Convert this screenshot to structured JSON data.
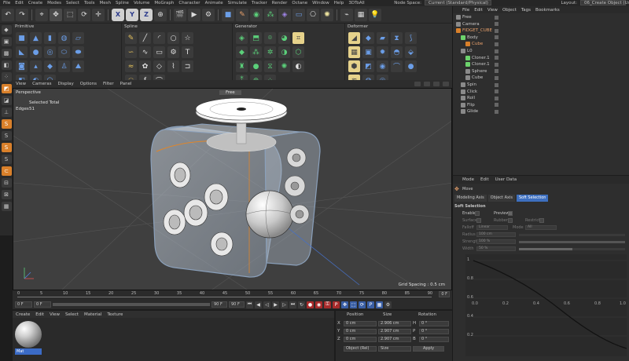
{
  "menubar": {
    "items": [
      "File",
      "Edit",
      "Create",
      "Modes",
      "Select",
      "Tools",
      "Mesh",
      "Spline",
      "Volume",
      "MoGraph",
      "Character",
      "Animate",
      "Simulate",
      "Tracker",
      "Render",
      "Octane",
      "Window",
      "Help",
      "3DToAll"
    ],
    "node_space_label": "Node Space:",
    "node_space_value": "Current (Standard/Physical)",
    "layout_label": "Layout:",
    "layout_value": "06_Create Object (User)"
  },
  "palette": {
    "primitive_title": "Primitive",
    "spline_title": "Spline",
    "generator_title": "Generator",
    "deformer_title": "Deformer"
  },
  "viewport": {
    "menu": [
      "View",
      "Cameras",
      "Display",
      "Options",
      "Filter",
      "Panel"
    ],
    "perspective": "Perspective",
    "selected_total": "Selected Total",
    "edges_label": "Edges",
    "edges_value": "51",
    "camera_mode": "Free",
    "grid_spacing": "Grid Spacing : 0.5 cm"
  },
  "timeline": {
    "ticks": [
      "0",
      "5",
      "10",
      "15",
      "20",
      "25",
      "30",
      "35",
      "40",
      "45",
      "50",
      "55",
      "60",
      "65",
      "70",
      "75",
      "80",
      "85",
      "90"
    ],
    "current_frame": "0 F",
    "start_frame": "0 F",
    "end_frame": "90 F",
    "max_frame": "90 F",
    "frame_right": "0 F"
  },
  "material": {
    "menu": [
      "Create",
      "Edit",
      "View",
      "Select",
      "Material",
      "Texture"
    ],
    "mat_name": "Mat"
  },
  "coords": {
    "pos_header": "Position",
    "size_header": "Size",
    "rot_header": "Rotation",
    "rows": [
      {
        "axis": "X",
        "pos": "0 cm",
        "size": "2.906 cm",
        "rlab": "H",
        "rot": "0 °"
      },
      {
        "axis": "Y",
        "pos": "0 cm",
        "size": "2.907 cm",
        "rlab": "P",
        "rot": "0 °"
      },
      {
        "axis": "Z",
        "pos": "0 cm",
        "size": "2.907 cm",
        "rlab": "B",
        "rot": "0 °"
      }
    ],
    "object_mode": "Object (Rel)",
    "size_mode": "Size",
    "apply": "Apply"
  },
  "objects": {
    "menu": [
      "File",
      "Edit",
      "View",
      "Object",
      "Tags",
      "Bookmarks"
    ],
    "items": [
      {
        "name": "Free",
        "indent": 0,
        "color": "#8a8a8a"
      },
      {
        "name": "Camera",
        "indent": 0,
        "color": "#8a8a8a"
      },
      {
        "name": "FIDGET_CUBE",
        "indent": 0,
        "color": "#d9802a"
      },
      {
        "name": "Body",
        "indent": 1,
        "color": "#6cd36c"
      },
      {
        "name": "Cube",
        "indent": 2,
        "color": "#d9802a"
      },
      {
        "name": "L0",
        "indent": 1,
        "color": "#8a8a8a"
      },
      {
        "name": "Cloner.1",
        "indent": 2,
        "color": "#6cd36c"
      },
      {
        "name": "Cloner.1",
        "indent": 2,
        "color": "#6cd36c"
      },
      {
        "name": "Sphere",
        "indent": 2,
        "color": "#8a8a8a"
      },
      {
        "name": "Cube",
        "indent": 2,
        "color": "#8a8a8a"
      },
      {
        "name": "Spin",
        "indent": 1,
        "color": "#8a8a8a"
      },
      {
        "name": "Click",
        "indent": 1,
        "color": "#8a8a8a"
      },
      {
        "name": "Roll",
        "indent": 1,
        "color": "#8a8a8a"
      },
      {
        "name": "Flip",
        "indent": 1,
        "color": "#8a8a8a"
      },
      {
        "name": "Glide",
        "indent": 1,
        "color": "#8a8a8a"
      }
    ]
  },
  "attributes": {
    "menu": [
      "Mode",
      "Edit",
      "User Data"
    ],
    "tool": "Move",
    "tabs": [
      "Modeling Axis",
      "Object Axis",
      "Soft Selection"
    ],
    "active_tab": 2,
    "section": "Soft Selection",
    "enable": "Enable",
    "preview": "Preview",
    "surface": "Surface",
    "rubber": "Rubber",
    "restrict": "Restrict",
    "falloff": "Falloff",
    "falloff_val": "Linear",
    "mode": "Mode",
    "mode_val": "All",
    "radius": "Radius",
    "radius_val": "100 cm",
    "strength": "Strength",
    "strength_val": "100 %",
    "width": "Width",
    "width_val": "50 %",
    "graph_y": [
      "1",
      "0.8",
      "0.6",
      "0.4",
      "0.2"
    ],
    "graph_x": [
      "0.0",
      "0.2",
      "0.4",
      "0.6",
      "0.8",
      "1.0"
    ]
  }
}
